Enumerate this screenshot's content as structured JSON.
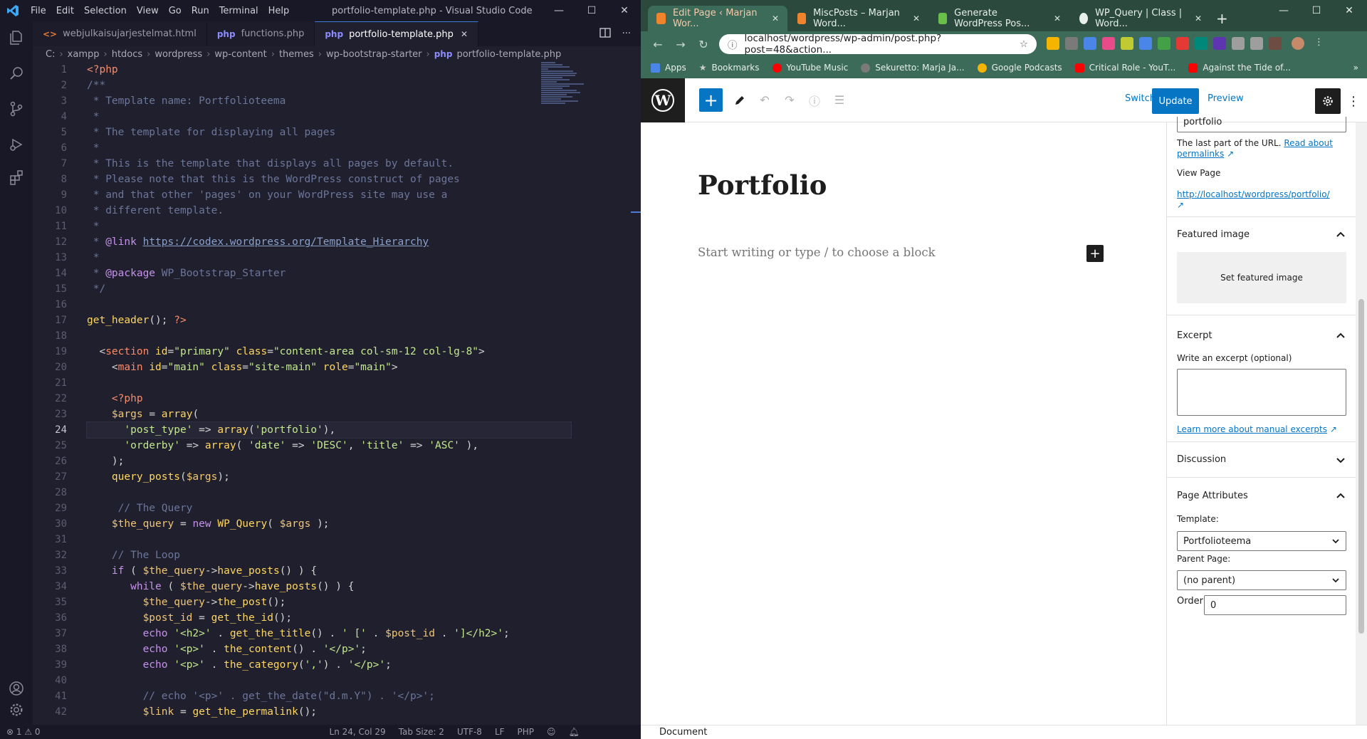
{
  "vscode": {
    "menu": [
      "File",
      "Edit",
      "Selection",
      "View",
      "Go",
      "Run",
      "Terminal",
      "Help"
    ],
    "window_title": "portfolio-template.php - Visual Studio Code",
    "tabs": [
      {
        "label": "webjulkaisujarjestelmat.html",
        "type": "html"
      },
      {
        "label": "functions.php",
        "type": "php"
      },
      {
        "label": "portfolio-template.php",
        "type": "php",
        "active": true
      }
    ],
    "breadcrumb": [
      "C:",
      "xampp",
      "htdocs",
      "wordpress",
      "wp-content",
      "themes",
      "wp-bootstrap-starter",
      "portfolio-template.php"
    ],
    "line_numbers": [
      "1",
      "2",
      "3",
      "4",
      "5",
      "6",
      "7",
      "8",
      "9",
      "10",
      "11",
      "12",
      "13",
      "14",
      "15",
      "16",
      "17",
      "18",
      "19",
      "20",
      "21",
      "22",
      "23",
      "24",
      "25",
      "26",
      "27",
      "28",
      "29",
      "30",
      "31",
      "32",
      "33",
      "34",
      "35",
      "36",
      "37",
      "38",
      "39",
      "40",
      "41",
      "42"
    ],
    "status": {
      "problems": "⊗ 1 ⚠ 0",
      "position": "Ln 24, Col 29",
      "tab_size": "Tab Size: 2",
      "encoding": "UTF-8",
      "eol": "LF",
      "language": "PHP"
    }
  },
  "browser": {
    "tabs": [
      {
        "label": "Edit Page ‹ Marjan Wor...",
        "favicon_color": "#f0842c",
        "active": true
      },
      {
        "label": "MiscPosts – Marjan Word...",
        "favicon_color": "#f0842c"
      },
      {
        "label": "Generate WordPress Pos...",
        "favicon_color": "#6abf4b"
      },
      {
        "label": "WP_Query | Class | Word...",
        "favicon_color": "#e6efe9"
      }
    ],
    "url": "localhost/wordpress/wp-admin/post.php?post=48&action...",
    "bookmarks": [
      {
        "label": "Apps",
        "color": "#4a86e8"
      },
      {
        "label": "Bookmarks",
        "color": "#cccccc"
      },
      {
        "label": "YouTube Music",
        "color": "#ff0000"
      },
      {
        "label": "Sekuretto: Marja Ja...",
        "color": "#7a7a7a"
      },
      {
        "label": "Google Podcasts",
        "color": "#f4b400"
      },
      {
        "label": "Critical Role - YouT...",
        "color": "#ff0000"
      },
      {
        "label": "Against the Tide of...",
        "color": "#ff0000"
      }
    ],
    "extension_colors": [
      "#f4b400",
      "#7a7a7a",
      "#4a86e8",
      "#e94b8a",
      "#c0ca33",
      "#4a86e8",
      "#43a047",
      "#e53935",
      "#00897b",
      "#5e35b1",
      "#9e9e9e",
      "#9e9e9e",
      "#6d4c41"
    ]
  },
  "wp": {
    "toolbar": {
      "switch_to_draft": "Switch to draft",
      "preview": "Preview",
      "update": "Update"
    },
    "title": "Portfolio",
    "placeholder": "Start writing or type / to choose a block",
    "sidebar": {
      "slug_value": "portfolio",
      "url_help": "The last part of the URL.",
      "read_about": "Read about",
      "permalinks": "permalinks",
      "view_page_label": "View Page",
      "view_page_link": "http://localhost/wordpress/portfolio/",
      "featured_image_title": "Featured image",
      "set_featured_image": "Set featured image",
      "excerpt_title": "Excerpt",
      "excerpt_label": "Write an excerpt (optional)",
      "excerpt_link": "Learn more about manual excerpts",
      "discussion_title": "Discussion",
      "page_attributes_title": "Page Attributes",
      "template_label": "Template:",
      "template_value": "Portfolioteema",
      "parent_label": "Parent Page:",
      "parent_value": "(no parent)",
      "order_label": "Order",
      "order_value": "0"
    },
    "footer": "Document"
  }
}
